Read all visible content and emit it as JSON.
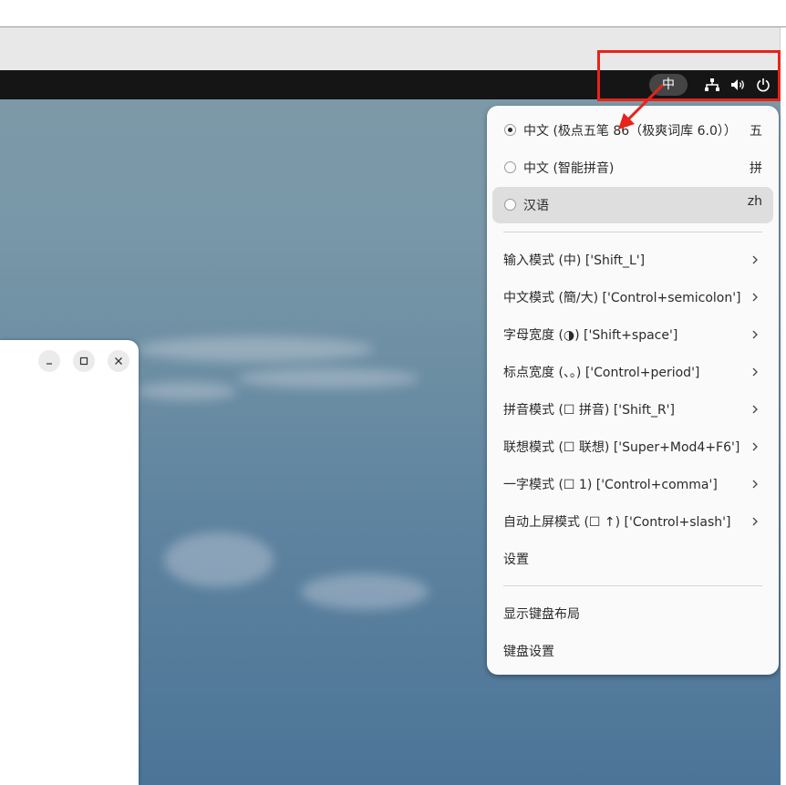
{
  "topbar": {
    "ime_indicator": "中",
    "tray_icons": [
      "network-icon",
      "volume-icon",
      "power-icon"
    ]
  },
  "input_menu": {
    "sources": [
      {
        "label": "中文 (极点五笔 86（极爽词库 6.0））",
        "shortcut": "五",
        "selected": true
      },
      {
        "label": "中文 (智能拼音)",
        "shortcut": "拼",
        "selected": false
      },
      {
        "label": "汉语",
        "shortcut": "zh",
        "selected": false
      }
    ],
    "modes": [
      {
        "label": "输入模式 (中) ['Shift_L']"
      },
      {
        "label": "中文模式 (簡/大) ['Control+semicolon']"
      },
      {
        "label": "字母宽度 (◑) ['Shift+space']"
      },
      {
        "label": "标点宽度 (、。) ['Control+period']"
      },
      {
        "label": "拼音模式 (☐ 拼音) ['Shift_R']"
      },
      {
        "label": "联想模式 (☐ 联想) ['Super+Mod4+F6']"
      },
      {
        "label": "一字模式 (☐ 1) ['Control+comma']"
      },
      {
        "label": "自动上屏模式 (☐ ↑) ['Control+slash']"
      }
    ],
    "settings": "设置",
    "show_layout": "显示键盘布局",
    "keyboard_settings": "键盘设置"
  },
  "colors": {
    "annotation": "#e8231a",
    "topbar": "#151515",
    "menu_bg": "#fafafa"
  }
}
